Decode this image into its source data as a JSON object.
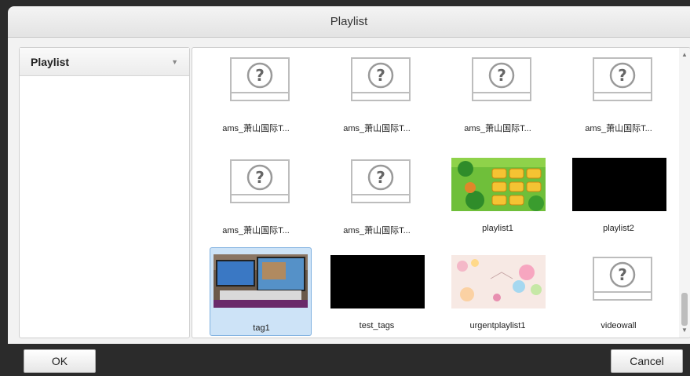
{
  "dialog": {
    "title": "Playlist"
  },
  "sidebar": {
    "header_label": "Playlist"
  },
  "items": [
    {
      "caption": "ams_萧山国际T...",
      "thumb": "question-icon"
    },
    {
      "caption": "ams_萧山国际T...",
      "thumb": "question-icon"
    },
    {
      "caption": "ams_萧山国际T...",
      "thumb": "question-icon"
    },
    {
      "caption": "ams_萧山国际T...",
      "thumb": "question-icon"
    },
    {
      "caption": "ams_萧山国际T...",
      "thumb": "question-icon"
    },
    {
      "caption": "ams_萧山国际T...",
      "thumb": "question-icon"
    },
    {
      "caption": "playlist1",
      "thumb": "game-image"
    },
    {
      "caption": "playlist2",
      "thumb": "black-image"
    },
    {
      "caption": "tag1",
      "thumb": "desk-photo",
      "selected": true
    },
    {
      "caption": "test_tags",
      "thumb": "black-image"
    },
    {
      "caption": "urgentplaylist1",
      "thumb": "pastel-image"
    },
    {
      "caption": "videowall",
      "thumb": "question-icon"
    }
  ],
  "buttons": {
    "ok_label": "OK",
    "cancel_label": "Cancel"
  }
}
